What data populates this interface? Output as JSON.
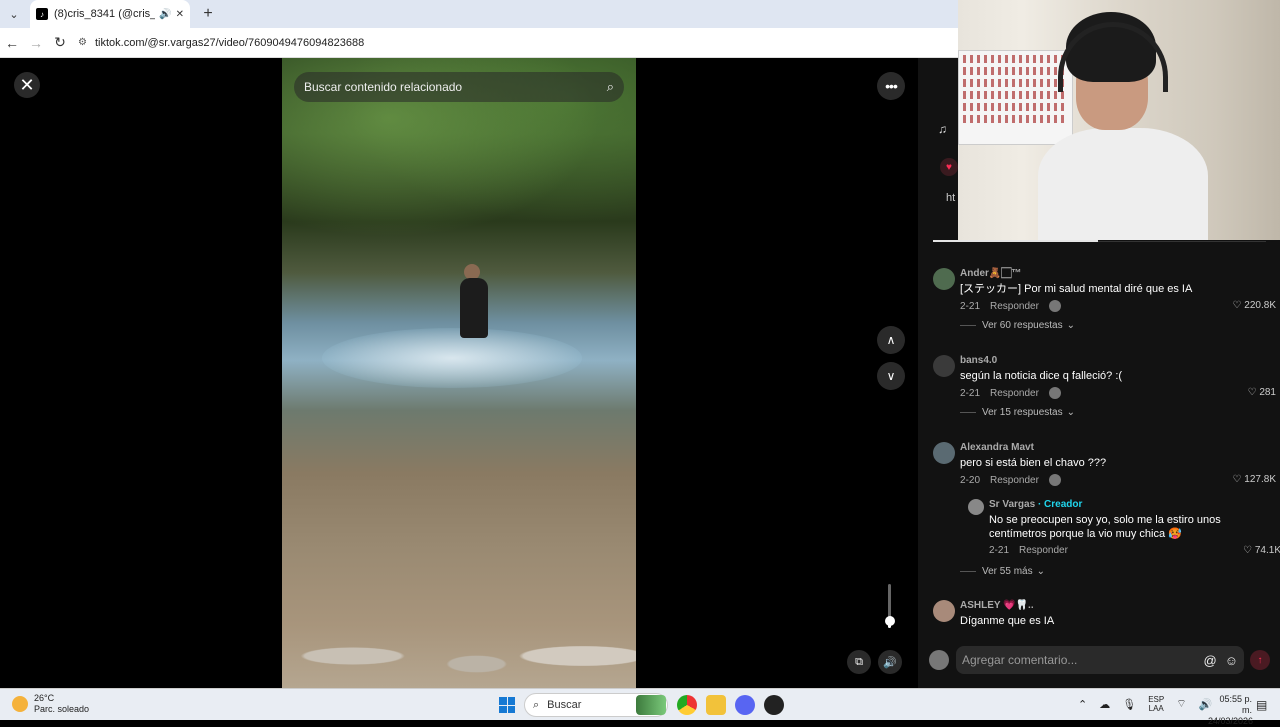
{
  "browser": {
    "tab_title": "(8)cris_8341 (@cris_8341) | T",
    "tab_favicon": "tiktok-icon",
    "url": "tiktok.com/@sr.vargas27/video/7609049476094823688"
  },
  "viewer": {
    "search_placeholder": "Buscar contenido relacionado",
    "volume_level": 0.2
  },
  "side": {
    "snippet": "ht"
  },
  "comments": [
    {
      "user": "Ander🧸🏻™",
      "text": "[ステッカー] Por mi salud mental diré que es IA",
      "date": "2-21",
      "reply": "Responder",
      "likes": "220.8K",
      "more": "Ver 60 respuestas"
    },
    {
      "user": "bans4.0",
      "text": "según la noticia dice q falleció? :(",
      "date": "2-21",
      "reply": "Responder",
      "likes": "281",
      "more": "Ver 15 respuestas"
    },
    {
      "user": "Alexandra Mavt",
      "text": "pero si está bien el chavo ???",
      "date": "2-20",
      "reply": "Responder",
      "likes": "127.8K",
      "more": ""
    }
  ],
  "reply": {
    "user": "Sr Vargas",
    "creator_label": "· Creador",
    "text": "No se preocupen soy yo, solo me la estiro unos centímetros porque la vio muy chica 🥵",
    "date": "2-21",
    "reply": "Responder",
    "likes": "74.1K",
    "more": "Ver 55 más"
  },
  "last_comment": {
    "user": "ASHLEY 💗🦷..",
    "text": "Díganme que es IA"
  },
  "comment_input": {
    "placeholder": "Agregar comentario..."
  },
  "taskbar": {
    "temperature": "26°C",
    "weather": "Parc. soleado",
    "search_label": "Buscar",
    "lang_top": "ESP",
    "lang_bottom": "LAA",
    "time": "05:55 p. m.",
    "date": "24/03/2026"
  },
  "colors": {
    "accent": "#fe2c55",
    "creator": "#20d5ec"
  }
}
